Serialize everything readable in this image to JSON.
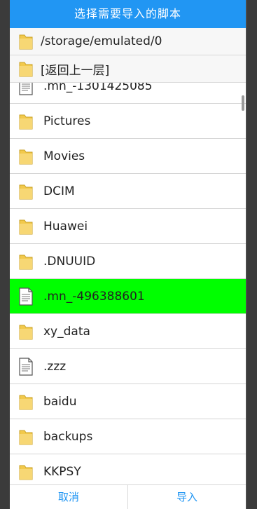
{
  "dialog": {
    "title": "选择需要导入的脚本",
    "current_path": "/storage/emulated/0",
    "back_label": "[返回上一层]"
  },
  "files": [
    {
      "name": ".mn_-1301425085",
      "type": "file"
    },
    {
      "name": "Pictures",
      "type": "folder"
    },
    {
      "name": "Movies",
      "type": "folder"
    },
    {
      "name": "DCIM",
      "type": "folder"
    },
    {
      "name": "Huawei",
      "type": "folder"
    },
    {
      "name": ".DNUUID",
      "type": "folder"
    },
    {
      "name": ".mn_-496388601",
      "type": "file",
      "selected": true
    },
    {
      "name": "xy_data",
      "type": "folder"
    },
    {
      "name": ".zzz",
      "type": "file"
    },
    {
      "name": "baidu",
      "type": "folder"
    },
    {
      "name": "backups",
      "type": "folder"
    },
    {
      "name": "KKPSY",
      "type": "folder"
    }
  ],
  "buttons": {
    "cancel": "取消",
    "import": "导入"
  },
  "colors": {
    "title_bar": "#2196f3",
    "selected_row": "#00ff00",
    "button_text": "#2196f3"
  }
}
